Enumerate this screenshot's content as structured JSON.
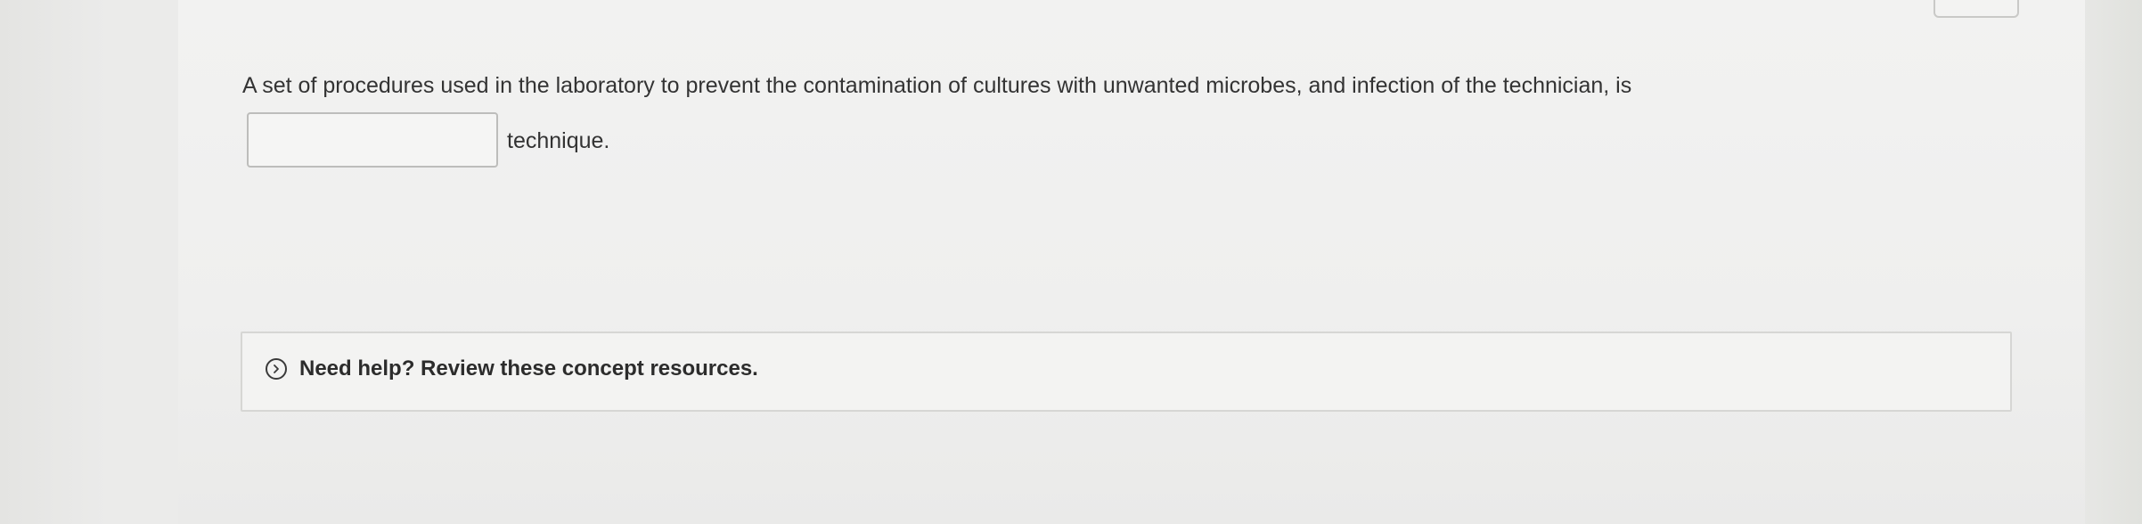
{
  "question": {
    "text": "A set of procedures used in the laboratory to prevent the contamination of cultures with unwanted microbes, and infection of the technician, is",
    "answer_value": "",
    "after_blank_text": "technique."
  },
  "help": {
    "label": "Need help? Review these concept resources.",
    "icon": "chevron-right-circle-icon"
  }
}
